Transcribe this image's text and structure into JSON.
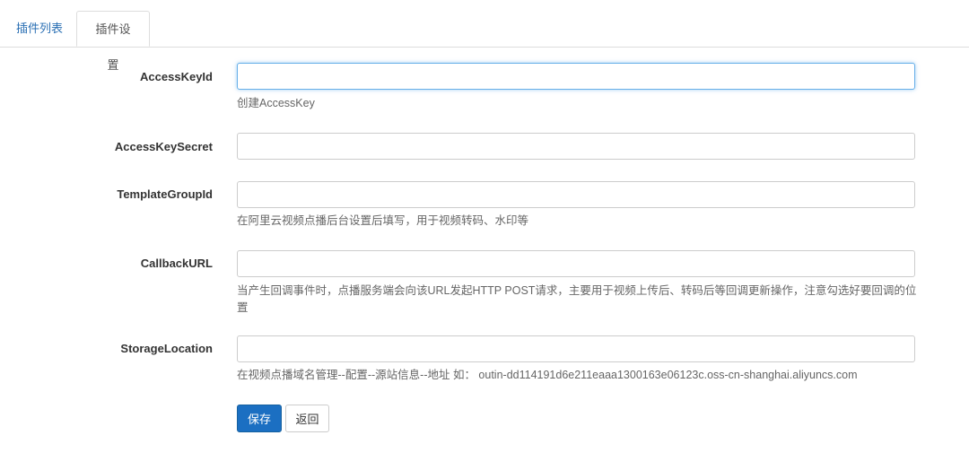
{
  "tabs": [
    {
      "label": "插件列表",
      "active": false
    },
    {
      "label": "插件设置",
      "active": true
    }
  ],
  "form": {
    "fields": [
      {
        "label": "AccessKeyId",
        "value": "",
        "help": "创建AccessKey"
      },
      {
        "label": "AccessKeySecret",
        "value": "",
        "help": ""
      },
      {
        "label": "TemplateGroupId",
        "value": "",
        "help": "在阿里云视频点播后台设置后填写，用于视频转码、水印等"
      },
      {
        "label": "CallbackURL",
        "value": "",
        "help": "当产生回调事件时，点播服务端会向该URL发起HTTP POST请求，主要用于视频上传后、转码后等回调更新操作，注意勾选好要回调的位置"
      },
      {
        "label": "StorageLocation",
        "value": "",
        "help": "在视频点播域名管理--配置--源站信息--地址 如： outin-dd114191d6e211eaaa1300163e06123c.oss-cn-shanghai.aliyuncs.com"
      }
    ]
  },
  "actions": {
    "save_label": "保存",
    "back_label": "返回"
  },
  "colors": {
    "primary": "#1b6fc2",
    "link": "#2a6fb4",
    "focus": "#66afe9"
  }
}
